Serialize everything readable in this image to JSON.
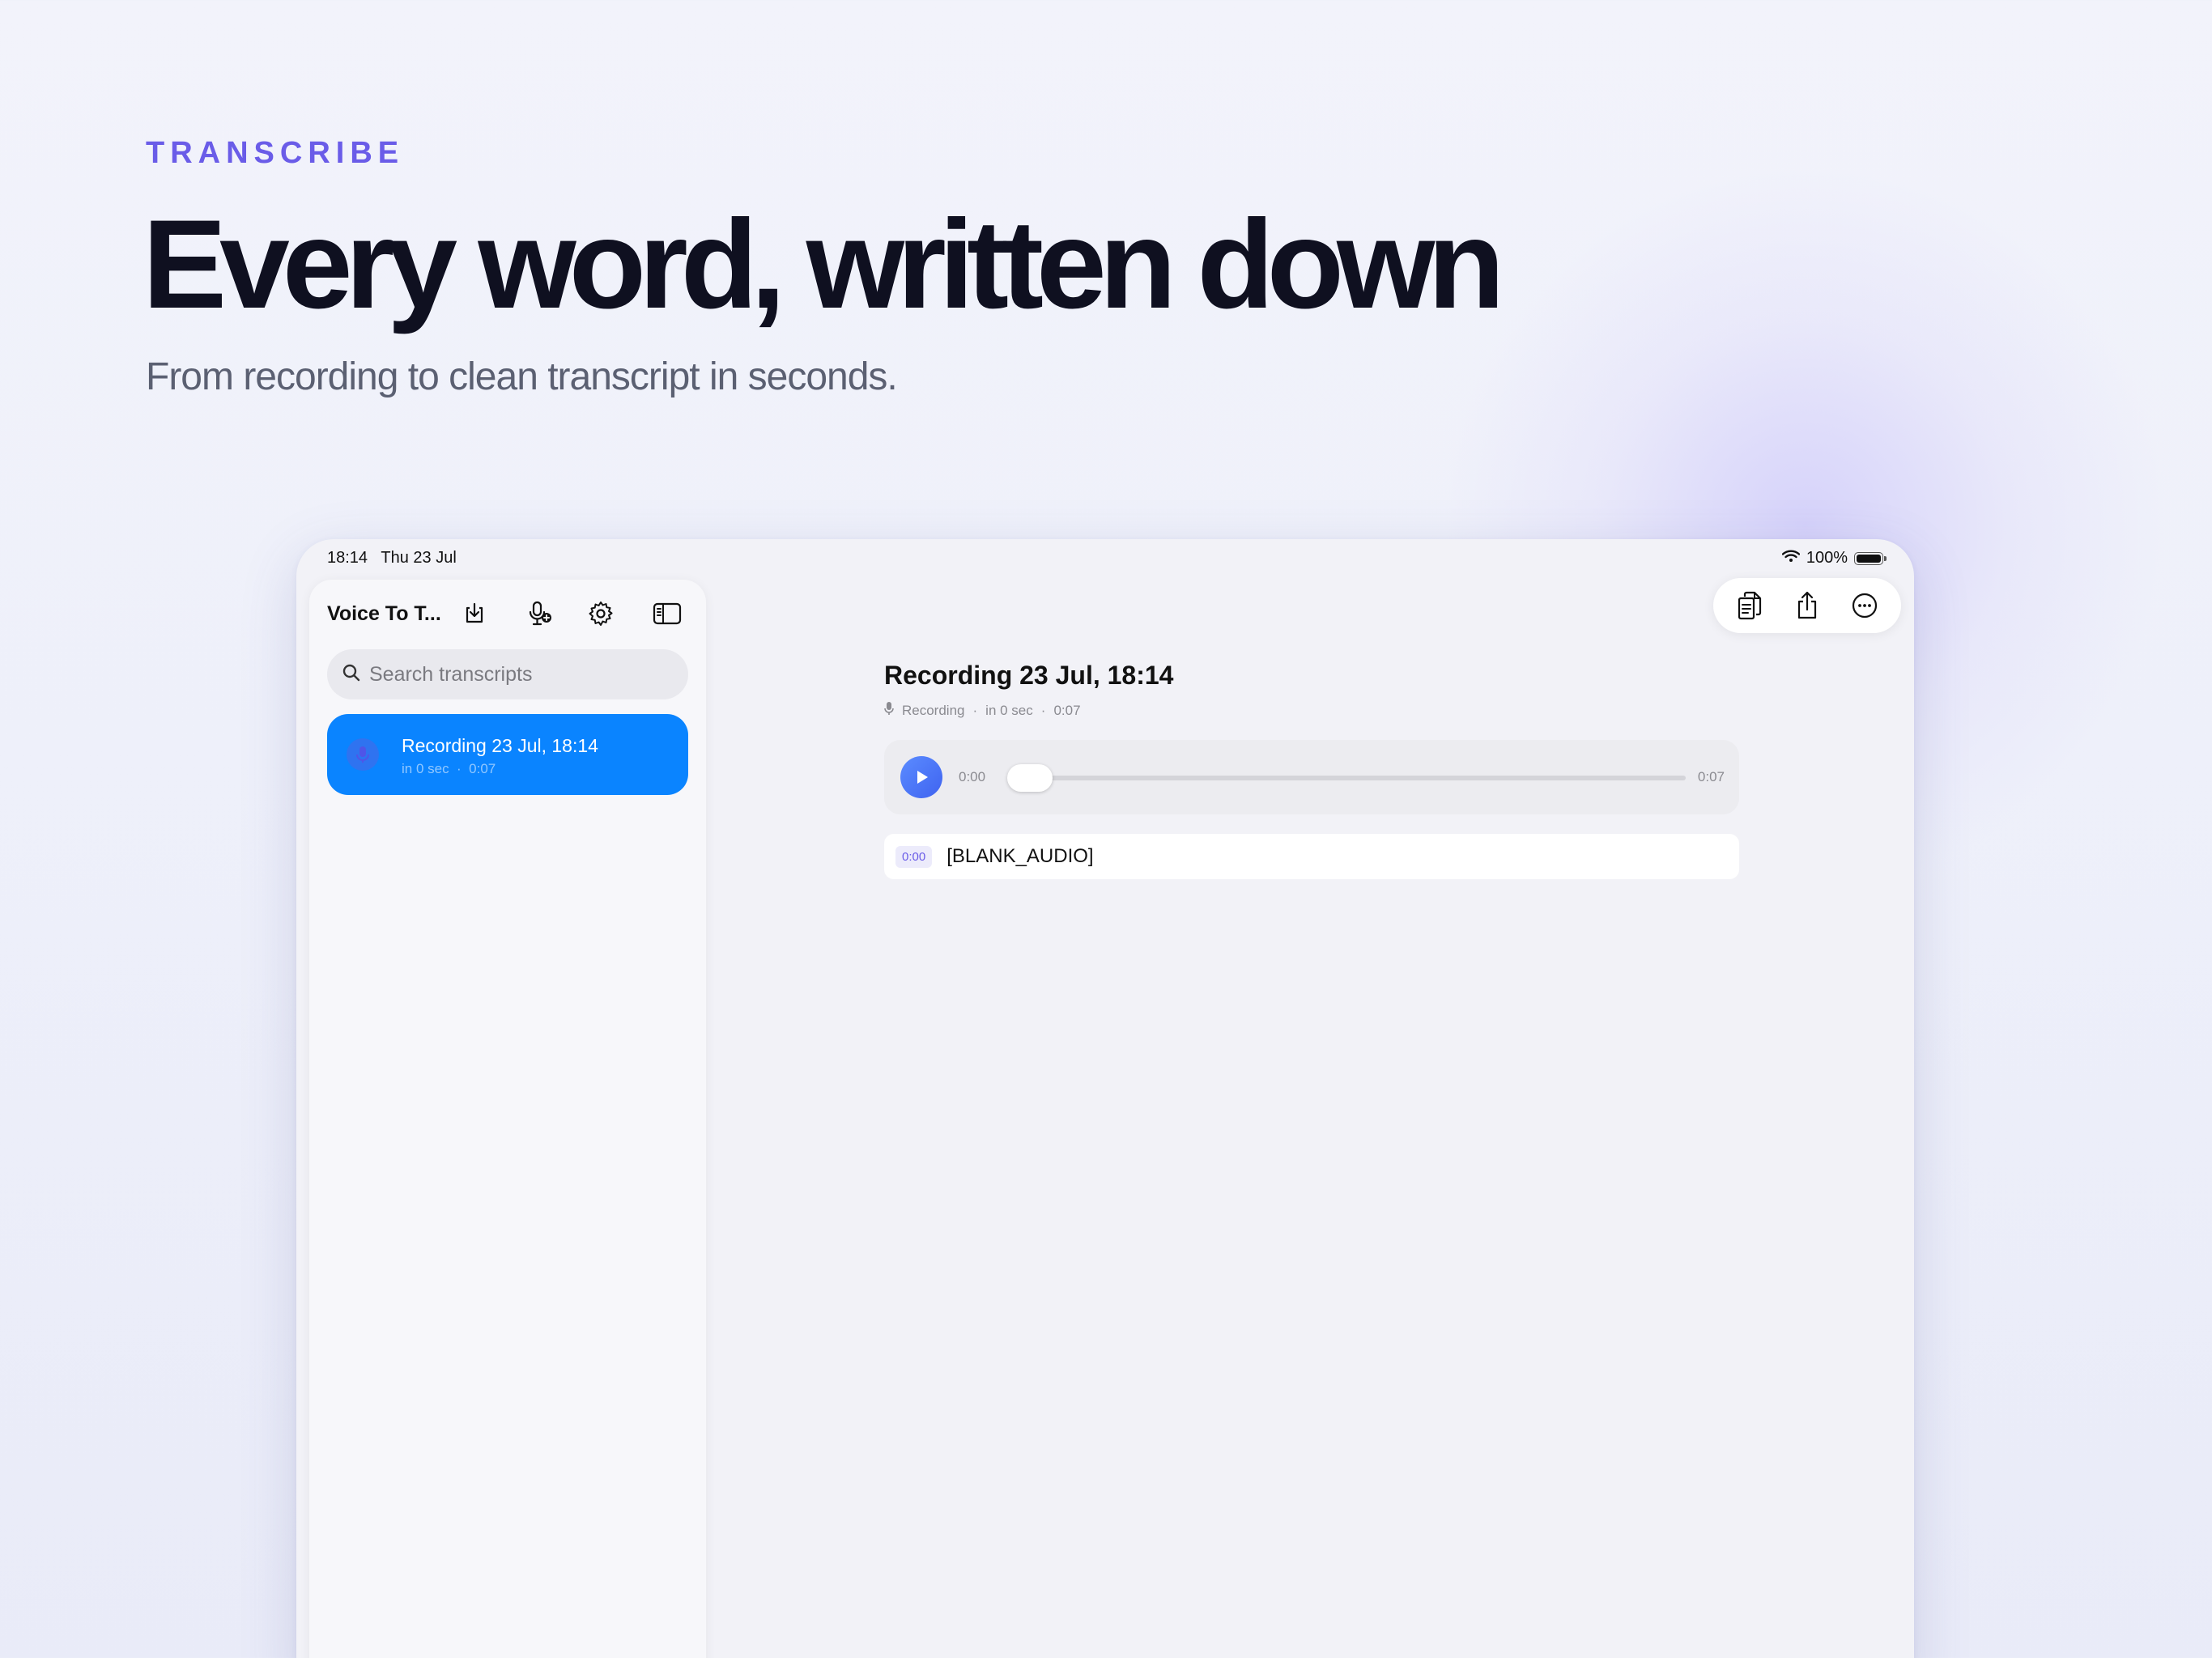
{
  "hero": {
    "eyebrow": "TRANSCRIBE",
    "headline": "Every word, written down",
    "subheadline": "From recording to clean transcript in seconds."
  },
  "status_bar": {
    "time": "18:14",
    "date": "Thu 23 Jul",
    "battery": "100%"
  },
  "sidebar": {
    "title": "Voice To T...",
    "search_placeholder": "Search transcripts",
    "items": [
      {
        "title": "Recording 23 Jul, 18:14",
        "ago": "in 0 sec",
        "duration": "0:07"
      }
    ]
  },
  "detail": {
    "title": "Recording 23 Jul, 18:14",
    "meta_kind": "Recording",
    "meta_ago": "in 0 sec",
    "meta_duration": "0:07",
    "separator": "·",
    "player": {
      "current": "0:00",
      "total": "0:07",
      "progress": 0
    },
    "segments": [
      {
        "time": "0:00",
        "text": "[BLANK_AUDIO]"
      }
    ]
  },
  "colors": {
    "accent_purple": "#6a5ce8",
    "selection_blue": "#0a84ff",
    "headline": "#0f1020"
  },
  "icons": {
    "import": "download-tray-icon",
    "new_recording": "mic-plus-icon",
    "settings": "gear-icon",
    "sidebar_toggle": "sidebar-icon",
    "copy": "copy-icon",
    "share": "share-icon",
    "more": "ellipsis-circle-icon"
  }
}
